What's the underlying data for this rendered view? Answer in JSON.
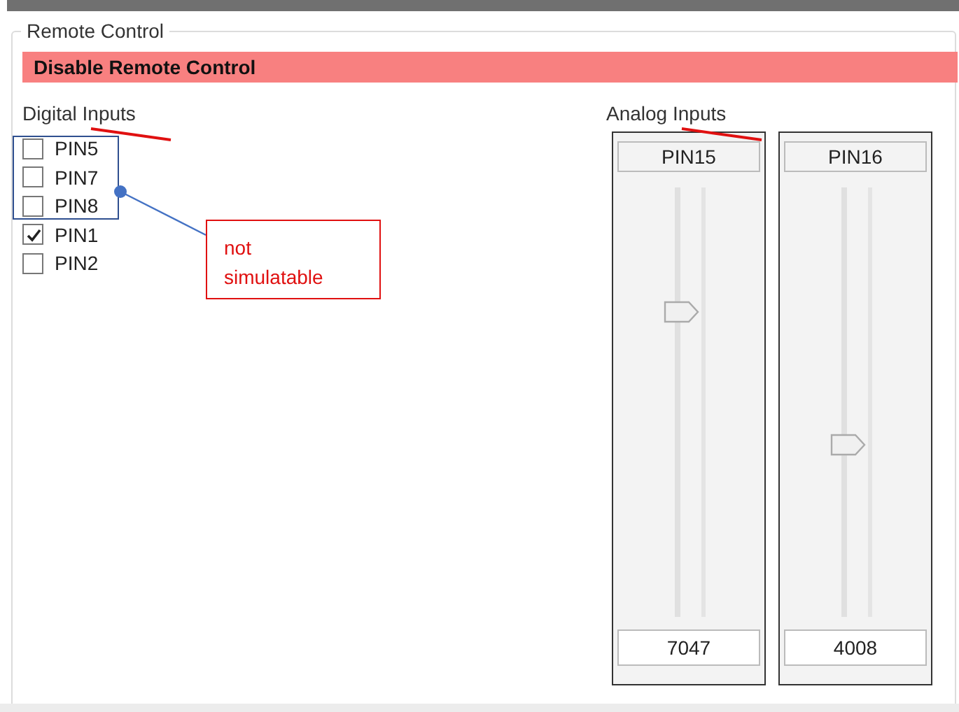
{
  "group": {
    "title": "Remote Control"
  },
  "disable_button": {
    "label": "Disable Remote Control"
  },
  "digital": {
    "label": "Digital Inputs",
    "pins": [
      {
        "label": "PIN5",
        "checked": false
      },
      {
        "label": "PIN7",
        "checked": false
      },
      {
        "label": "PIN8",
        "checked": false
      },
      {
        "label": "PIN1",
        "checked": true
      },
      {
        "label": "PIN2",
        "checked": false
      }
    ]
  },
  "analog": {
    "label": "Analog Inputs",
    "channels": [
      {
        "name": "PIN15",
        "level": 0.71,
        "value": "7047"
      },
      {
        "name": "PIN16",
        "level": 0.4,
        "value": "4008"
      }
    ]
  },
  "annotation": {
    "text": "not simulatable"
  }
}
